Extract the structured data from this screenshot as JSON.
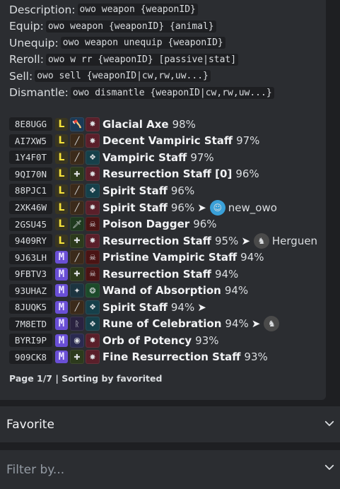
{
  "commands": [
    {
      "label": "Description:",
      "code": "owo weapon {weaponID}"
    },
    {
      "label": "Equip:",
      "code": "owo weapon {weaponID} {animal}"
    },
    {
      "label": "Unequip:",
      "code": "owo weapon unequip {weaponID}"
    },
    {
      "label": "Reroll:",
      "code": "owo w rr {weaponID} [passive|stat]"
    },
    {
      "label": "Sell:",
      "code": "owo sell {weaponID|cw,rw,uw...}"
    },
    {
      "label": "Dismantle:",
      "code": "owo dismantle {weaponID|cw,rw,uw...}"
    }
  ],
  "weapons": [
    {
      "id": "8E8UGG",
      "rarity": "legendary",
      "rarity_glyph": "L",
      "weapon_icon": "axe-icon",
      "passive_icon": "burst-icon",
      "name": "Glacial Axe",
      "percent": "98%",
      "owner": ""
    },
    {
      "id": "AI7XW5",
      "rarity": "legendary",
      "rarity_glyph": "L",
      "weapon_icon": "staff-icon",
      "passive_icon": "burst-icon",
      "name": "Decent Vampiric Staff",
      "percent": "97%",
      "owner": ""
    },
    {
      "id": "1Y4F0T",
      "rarity": "legendary",
      "rarity_glyph": "L",
      "weapon_icon": "staff-icon",
      "passive_icon": "mana-icon",
      "name": "Vampiric Staff",
      "percent": "97%",
      "owner": ""
    },
    {
      "id": "9QI70N",
      "rarity": "legendary",
      "rarity_glyph": "L",
      "weapon_icon": "resurrection-staff-icon",
      "passive_icon": "burst-icon",
      "name": "Resurrection Staff [0]",
      "percent": "96%",
      "owner": ""
    },
    {
      "id": "88PJC1",
      "rarity": "legendary",
      "rarity_glyph": "L",
      "weapon_icon": "staff-icon",
      "passive_icon": "mana-icon",
      "name": "Spirit Staff",
      "percent": "96%",
      "owner": ""
    },
    {
      "id": "2XK46W",
      "rarity": "legendary",
      "rarity_glyph": "L",
      "weapon_icon": "staff-icon",
      "passive_icon": "burst-icon",
      "name": "Spirit Staff",
      "percent": "96%",
      "owner": "new_owo"
    },
    {
      "id": "2GSU45",
      "rarity": "legendary",
      "rarity_glyph": "L",
      "weapon_icon": "dagger-icon",
      "passive_icon": "poison-icon",
      "name": "Poison Dagger",
      "percent": "96%",
      "owner": ""
    },
    {
      "id": "9409RY",
      "rarity": "legendary",
      "rarity_glyph": "L",
      "weapon_icon": "resurrection-staff-icon",
      "passive_icon": "burst-icon",
      "name": "Resurrection Staff",
      "percent": "95%",
      "owner": "Herguen"
    },
    {
      "id": "9J63LH",
      "rarity": "mythic",
      "rarity_glyph": "M",
      "weapon_icon": "staff-icon",
      "passive_icon": "poison-icon",
      "name": "Pristine Vampiric Staff",
      "percent": "94%",
      "owner": ""
    },
    {
      "id": "9FBTV3",
      "rarity": "mythic",
      "rarity_glyph": "M",
      "weapon_icon": "resurrection-staff-icon",
      "passive_icon": "poison-icon",
      "name": "Resurrection Staff",
      "percent": "94%",
      "owner": ""
    },
    {
      "id": "93UHAZ",
      "rarity": "mythic",
      "rarity_glyph": "M",
      "weapon_icon": "wand-icon",
      "passive_icon": "absorb-icon",
      "name": "Wand of Absorption",
      "percent": "94%",
      "owner": ""
    },
    {
      "id": "8JUQK5",
      "rarity": "mythic",
      "rarity_glyph": "M",
      "weapon_icon": "staff-icon",
      "passive_icon": "mana-icon",
      "name": "Spirit Staff",
      "percent": "94%",
      "owner": ""
    },
    {
      "id": "7M8ETD",
      "rarity": "mythic",
      "rarity_glyph": "M",
      "weapon_icon": "rune-icon",
      "passive_icon": "mana-icon",
      "name": "Rune of Celebration",
      "percent": "94%",
      "owner": ""
    },
    {
      "id": "BYRI9P",
      "rarity": "mythic",
      "rarity_glyph": "M",
      "weapon_icon": "orb-icon",
      "passive_icon": "burst-icon",
      "name": "Orb of Potency",
      "percent": "93%",
      "owner": ""
    },
    {
      "id": "909CK8",
      "rarity": "mythic",
      "rarity_glyph": "M",
      "weapon_icon": "resurrection-staff-icon",
      "passive_icon": "burst-icon",
      "name": "Fine Resurrection Staff",
      "percent": "93%",
      "owner": ""
    }
  ],
  "arrow_glyph": "➤",
  "footer": "Page 1/7 | Sorting by favorited",
  "favorite_select": {
    "label": "Favorite"
  },
  "filter_select": {
    "placeholder": "Filter by..."
  },
  "colors": {
    "background": "#1e1f22",
    "embed": "#2b2d31",
    "legendary": "#f5e23a",
    "mythic": "#6a4fd6"
  }
}
